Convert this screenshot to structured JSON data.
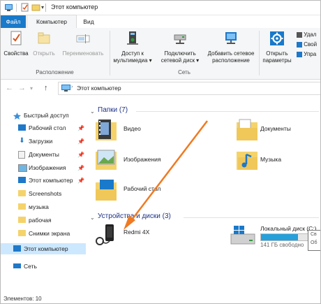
{
  "window": {
    "title": "Этот компьютер"
  },
  "tabs": {
    "file": "Файл",
    "computer": "Компьютер",
    "view": "Вид"
  },
  "ribbon": {
    "location": {
      "label": "Расположение",
      "properties": "Свойства",
      "open": "Открыть",
      "rename": "Переименовать"
    },
    "network": {
      "label": "Сеть",
      "media_access": [
        "Доступ к",
        "мультимедиа ▾"
      ],
      "map_drive": [
        "Подключить",
        "сетевой диск ▾"
      ],
      "add_location": [
        "Добавить сетевое",
        "расположение"
      ]
    },
    "system": {
      "open_settings": [
        "Открыть",
        "параметры"
      ],
      "remove": "Удал",
      "props": "Свой",
      "manage": "Упра"
    }
  },
  "address": {
    "path": "Этот компьютер",
    "back": "←",
    "forward": "→",
    "recent": "▾",
    "up": "↑"
  },
  "nav": {
    "quick_access": "Быстрый доступ",
    "items": [
      "Рабочий стол",
      "Загрузки",
      "Документы",
      "Изображения",
      "Этот компьютер",
      "Screenshots",
      "музыка",
      "рабочая",
      "Снимки экрана"
    ],
    "this_pc": "Этот компьютер",
    "network": "Сеть"
  },
  "content": {
    "folders_header": "Папки (7)",
    "folders": [
      "Видео",
      "Документы",
      "Изображения",
      "Музыка",
      "Рабочий стол"
    ],
    "devices_header": "Устройства и диски (3)",
    "device": "Redmi 4X",
    "disk": {
      "name": "Локальный диск (C:)",
      "free": "141 ГБ свободно",
      "used_fraction": 0.72
    },
    "tooltip": [
      "Св",
      "Об"
    ]
  },
  "status": {
    "items": "Элементов: 10"
  },
  "colors": {
    "accent": "#1979ca",
    "arrow": "#f07a21",
    "selection": "#cce8ff",
    "header": "#1e3287"
  }
}
